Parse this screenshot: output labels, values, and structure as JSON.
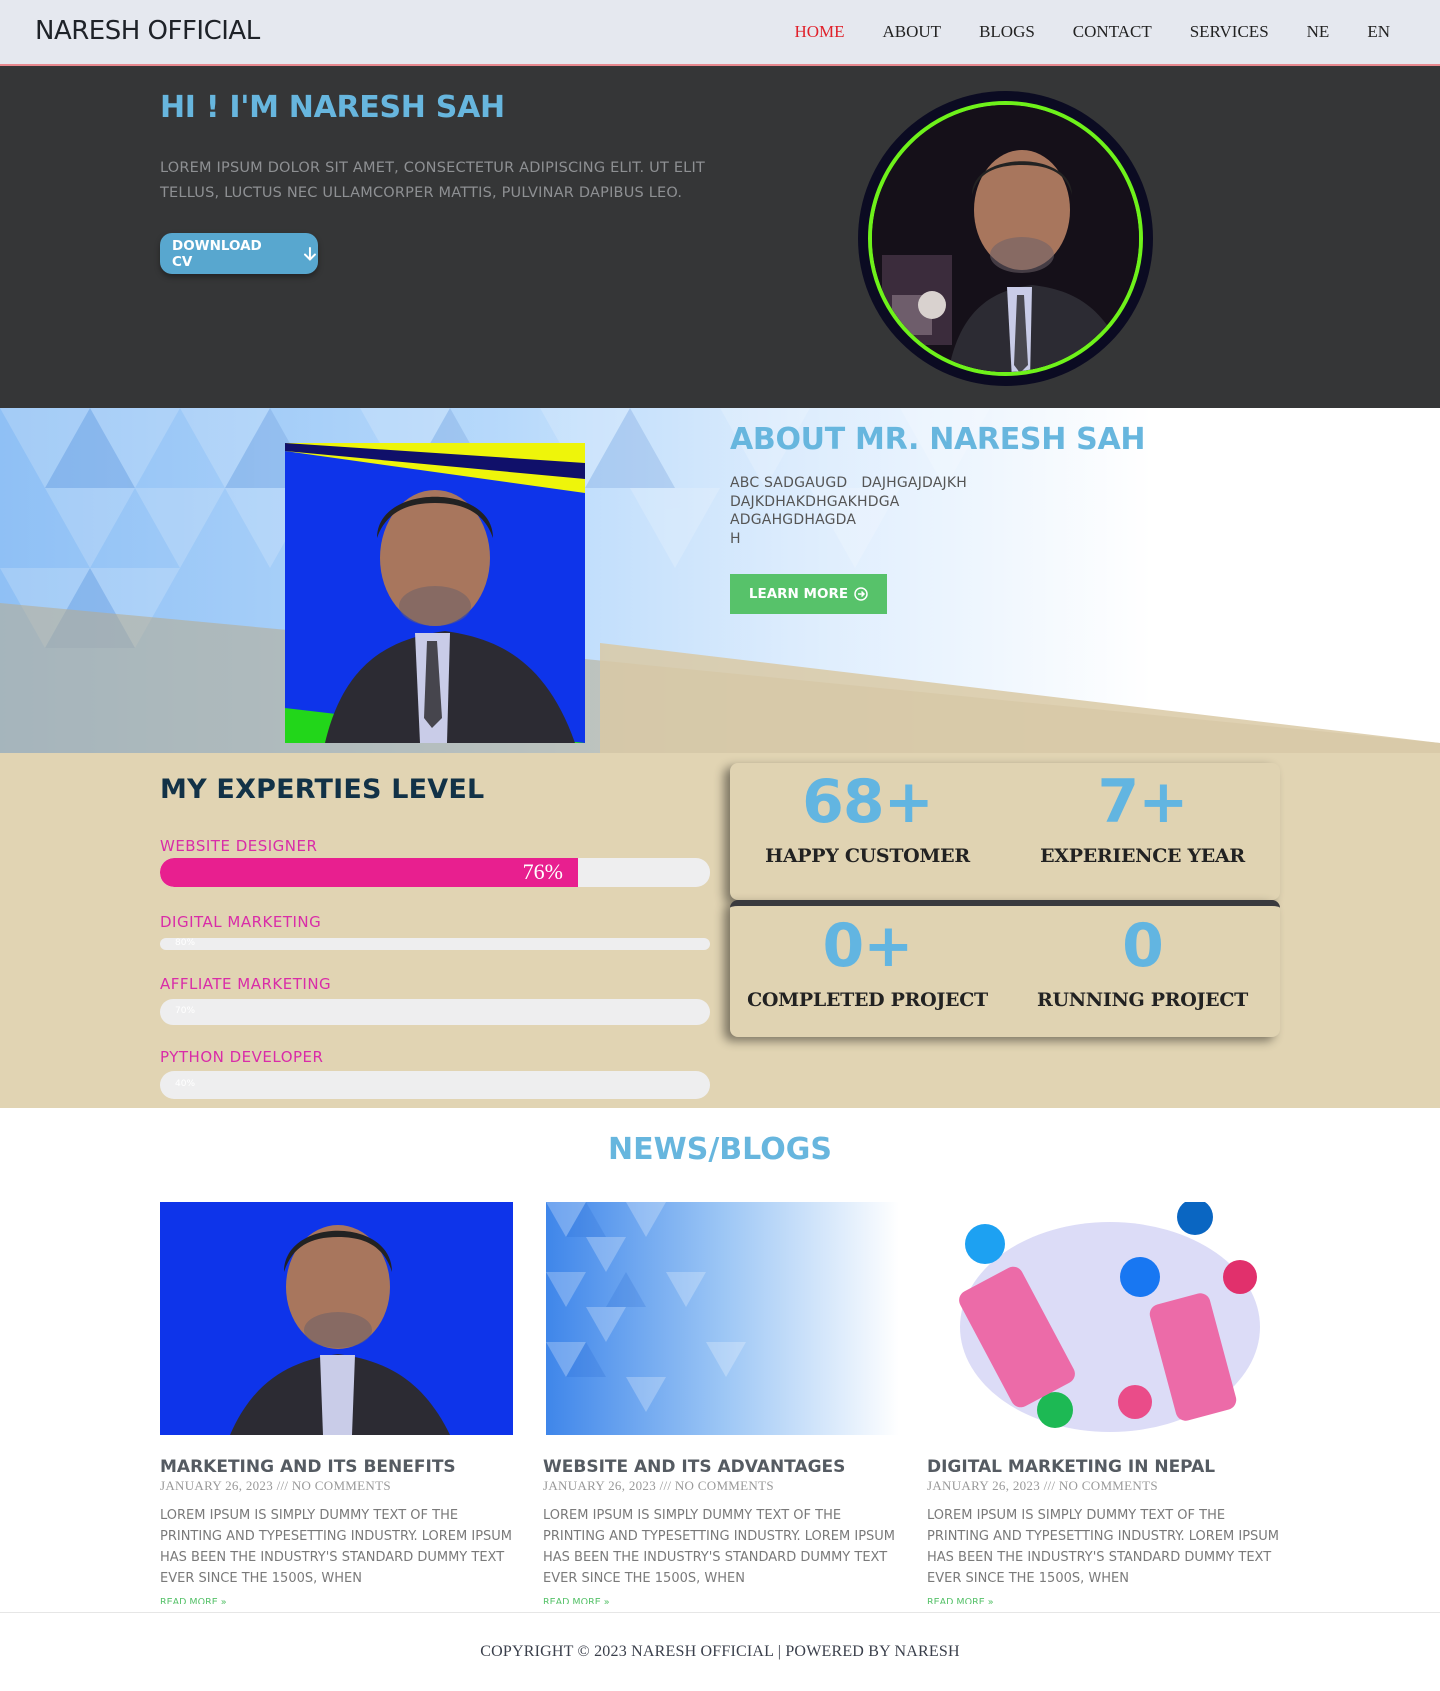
{
  "header": {
    "logo": "NARESH OFFICIAL",
    "nav": [
      "HOME",
      "ABOUT",
      "BLOGS",
      "CONTACT",
      "SERVICES",
      "NE",
      "EN"
    ]
  },
  "hero": {
    "title": "HI ! I'M NARESH SAH",
    "text": "LOREM IPSUM DOLOR SIT AMET, CONSECTETUR ADIPISCING ELIT. UT ELIT TELLUS, LUCTUS NEC ULLAMCORPER MATTIS, PULVINAR DAPIBUS LEO.",
    "cv_button": "DOWNLOAD CV"
  },
  "about": {
    "title": "ABOUT MR. NARESH SAH",
    "lines": [
      "ABC SADGAUGD   DAJHGAJDAJKH",
      "DAJKDHAKDHGAKHDGA",
      "ADGAHGDHAGDA",
      "H"
    ],
    "button": "LEARN MORE"
  },
  "experties": {
    "title": "MY EXPERTIES LEVEL",
    "skills": [
      {
        "label": "WEBSITE  DESIGNER",
        "percent": 76,
        "pct_label": "76%"
      },
      {
        "label": "DIGITAL MARKETING",
        "percent": 0,
        "pct_label": "80%"
      },
      {
        "label": "AFFLIATE MARKETING",
        "percent": 0,
        "pct_label": "70%"
      },
      {
        "label": "PYTHON DEVELOPER",
        "percent": 0,
        "pct_label": "40%"
      }
    ]
  },
  "stats": [
    {
      "number": "68+",
      "label": "HAPPY CUSTOMER"
    },
    {
      "number": "7+",
      "label": "EXPERIENCE YEAR"
    },
    {
      "number": "0+",
      "label": "COMPLETED PROJECT"
    },
    {
      "number": "0",
      "label": "RUNNING PROJECT"
    }
  ],
  "news": {
    "title": "NEWS/BLOGS",
    "posts": [
      {
        "title": "MARKETING AND ITS BENEFITS",
        "meta": "JANUARY 26, 2023 /// NO COMMENTS",
        "excerpt": "LOREM IPSUM IS SIMPLY DUMMY TEXT OF THE PRINTING AND TYPESETTING INDUSTRY. LOREM IPSUM HAS BEEN THE INDUSTRY'S STANDARD DUMMY TEXT EVER SINCE THE 1500S, WHEN",
        "more": "READ MORE »"
      },
      {
        "title": "WEBSITE AND ITS ADVANTAGES",
        "meta": "JANUARY 26, 2023 /// NO COMMENTS",
        "excerpt": "LOREM IPSUM IS SIMPLY DUMMY TEXT OF THE PRINTING AND TYPESETTING INDUSTRY. LOREM IPSUM HAS BEEN THE INDUSTRY'S STANDARD DUMMY TEXT EVER SINCE THE 1500S, WHEN",
        "more": "READ MORE »"
      },
      {
        "title": "DIGITAL MARKETING IN NEPAL",
        "meta": "JANUARY 26, 2023 /// NO COMMENTS",
        "excerpt": "LOREM IPSUM IS SIMPLY DUMMY TEXT OF THE PRINTING AND TYPESETTING INDUSTRY. LOREM IPSUM HAS BEEN THE INDUSTRY'S STANDARD DUMMY TEXT EVER SINCE THE 1500S, WHEN",
        "more": "READ MORE »"
      }
    ]
  },
  "footer": {
    "text": "COPYRIGHT © 2023 NARESH OFFICIAL | POWERED BY NARESH"
  },
  "colors": {
    "accent_blue": "#67b6de",
    "skill_pink": "#e81f8f",
    "label_magenta": "#d92ca8",
    "green": "#57c26a",
    "nav_active": "#e0212b",
    "hero_bg": "#353637",
    "experties_bg": "#e1d4b3"
  }
}
